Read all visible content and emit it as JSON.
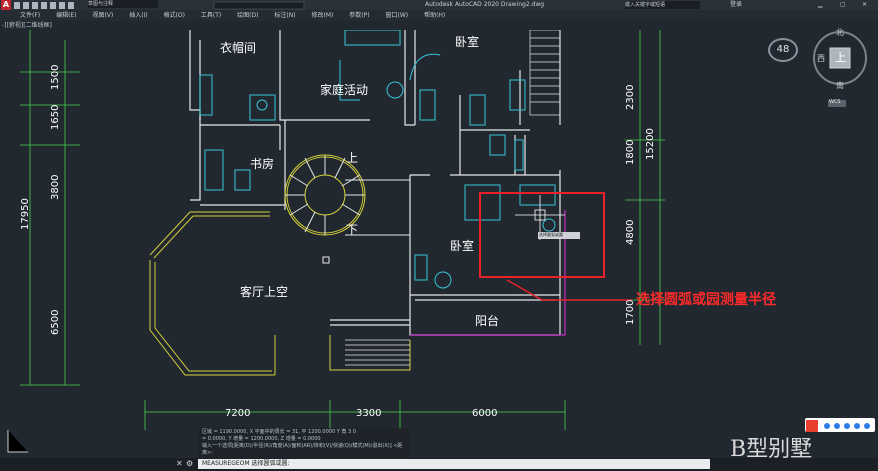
{
  "app": {
    "title": "Autodesk AutoCAD 2020   Drawing2.dwg",
    "search_placeholder": "键入关键字或短语",
    "login_label": "登录",
    "workspace": "草图与注释"
  },
  "menu": [
    "文件(F)",
    "编辑(E)",
    "视图(V)",
    "插入(I)",
    "格式(O)",
    "工具(T)",
    "绘图(D)",
    "标注(N)",
    "修改(M)",
    "参数(P)",
    "窗口(W)",
    "帮助(H)"
  ],
  "view_tab": "-][俯视][二维线框]",
  "viewcube": {
    "north": "北",
    "south": "南",
    "west": "西",
    "east": "东",
    "top": "上",
    "wcs": "WCS"
  },
  "zoom_label": "48",
  "rooms": {
    "cloakroom": "衣帽间",
    "family": "家庭活动",
    "bedroom_top": "卧室",
    "study": "书房",
    "stairs_up": "上",
    "stairs_down": "下",
    "living": "客厅上空",
    "bedroom_mid": "卧室",
    "balcony": "阳台"
  },
  "dims_bottom": [
    "7200",
    "3300",
    "6000"
  ],
  "dims_left": [
    "1500",
    "1650",
    "3800",
    "6500"
  ],
  "dims_left_total": "17950",
  "dims_right": [
    "2300",
    "1800",
    "4800",
    "1700"
  ],
  "dims_right_total": "15200",
  "tooltip": "选择圆弧或圆",
  "annotation": "选择圆弧或园测量半径",
  "watermark": "B型别墅",
  "coords": [
    "区域 = 1190.0000,  X 平面中的周长 = 31,  平 1200.0000 Y 角 3 0",
    "= 0.0000,  Y 增量 = 1200.0000,  Z 增量 = 0.0000",
    "输入一个选项[距离(D)/半径(R)/角度(A)/面积(AR)/体积(V)/快速(Q)/模式(M)/退出(X)] <距离>:"
  ],
  "command_prompt": "MEASUREGEOM 选择圆弧或圆:",
  "activate": "激活 Windows"
}
